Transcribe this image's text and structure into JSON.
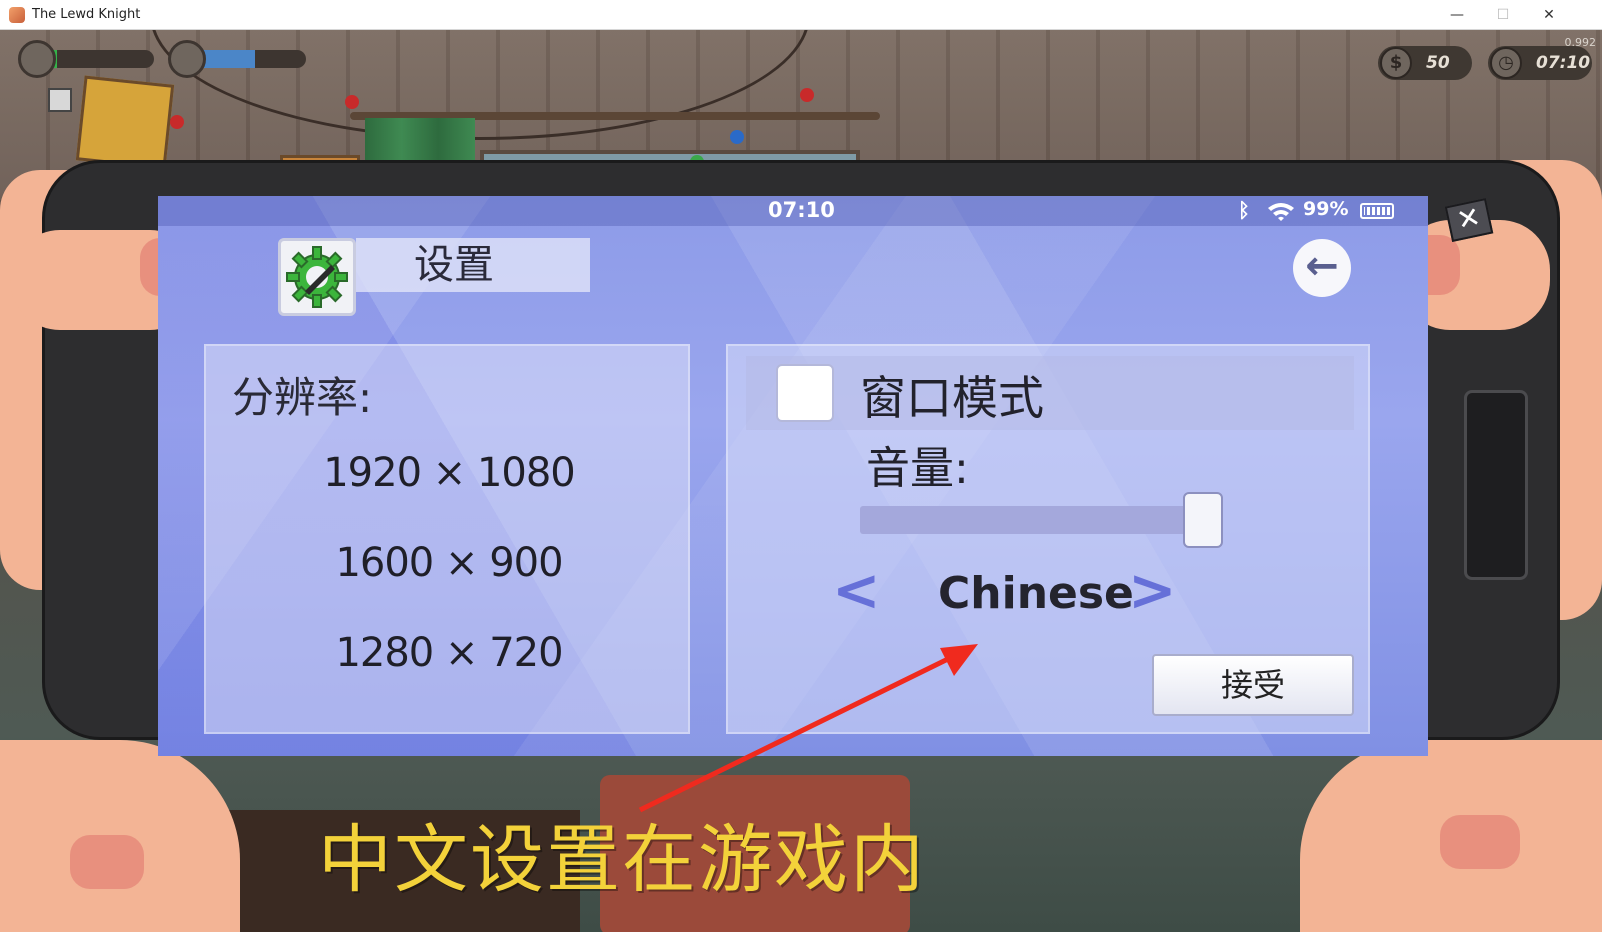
{
  "window": {
    "title": "The Lewd Knight",
    "minimize_label": "—",
    "maximize_label": "☐",
    "close_label": "✕"
  },
  "hud": {
    "health_fill": 0.12,
    "stamina_fill": 0.55,
    "coins": "50",
    "time": "07:10",
    "fps": "0.992",
    "colors": {
      "health": "#35b24a",
      "stamina": "#4b86c8"
    }
  },
  "phone": {
    "status": {
      "clock": "07:10",
      "battery": "99%",
      "bluetooth_icon": "bluetooth-icon",
      "wifi_icon": "wifi-icon"
    },
    "header": {
      "title": "设置",
      "icon": "gear-wrench-icon"
    },
    "back_icon": "back-arrow-icon",
    "close_label": "✕",
    "resolution": {
      "label": "分辨率:",
      "options": [
        "1920 × 1080",
        "1600 × 900",
        "1280 × 720"
      ]
    },
    "windowed": {
      "label": "窗口模式",
      "checked": false
    },
    "volume": {
      "label": "音量:",
      "level": 0.98
    },
    "language": {
      "prev": "<",
      "value": "Chinese",
      "next": ">"
    },
    "accept_label": "接受"
  },
  "caption": "中文设置在游戏内",
  "colors": {
    "caption": "#f3d23a",
    "arrow": "#f02a1e",
    "screen_accent": "#8d9be8"
  }
}
